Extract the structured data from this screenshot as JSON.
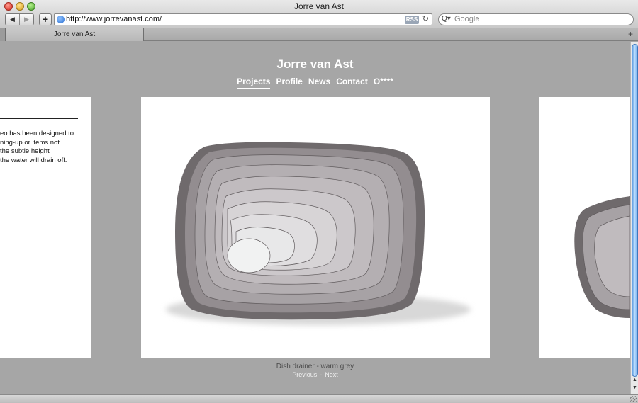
{
  "window": {
    "title": "Jorre van Ast"
  },
  "toolbar": {
    "back": "◀",
    "forward": "▶",
    "add": "+",
    "url": "http://www.jorrevanast.com/",
    "rss": "RSS",
    "reload": "↻",
    "search_placeholder": "Google",
    "search_icon": "Q▾"
  },
  "tabs": [
    {
      "label": "Jorre van Ast"
    }
  ],
  "new_tab": "+",
  "site": {
    "title": "Jorre van Ast",
    "menu": [
      {
        "label": "Projects",
        "active": true
      },
      {
        "label": "Profile",
        "active": false
      },
      {
        "label": "News",
        "active": false
      },
      {
        "label": "Contact",
        "active": false
      },
      {
        "label": "O****",
        "active": false
      }
    ]
  },
  "left_panel": {
    "lines": [
      "eo has been designed to",
      "ning-up or items not",
      " the subtle height",
      "the water will drain off."
    ]
  },
  "caption": "Dish drainer - warm grey",
  "pager": {
    "previous": "Previous",
    "separator": "-",
    "next": "Next"
  },
  "scroll": {
    "up": "▲",
    "down": "▼"
  },
  "colors": {
    "page_bg": "#a6a6a6",
    "tray_dark": "#6f6a6c",
    "tray_light": "#eef0f0",
    "thumb": "#6ea9ea"
  }
}
